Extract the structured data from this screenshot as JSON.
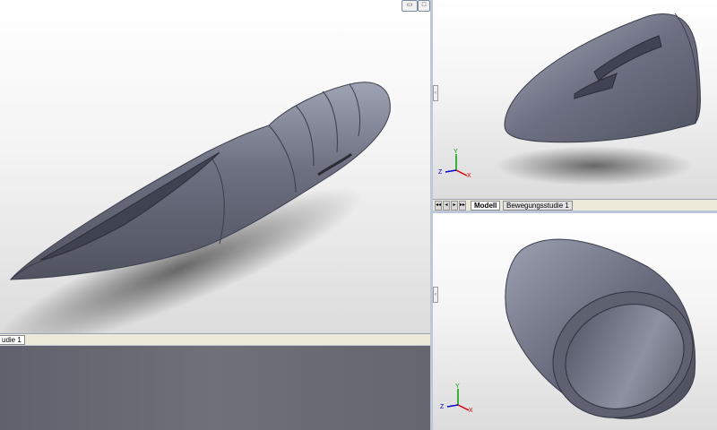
{
  "left_view": {
    "tab_label": "udie 1",
    "window_buttons": [
      "▭",
      "□"
    ]
  },
  "top_right_view": {
    "tabs": [
      {
        "label": "Modell",
        "active": true
      },
      {
        "label": "Bewegungsstudie 1",
        "active": false
      }
    ],
    "nav_buttons": [
      "◂◂",
      "◂",
      "▸",
      "▸▸"
    ],
    "triad": {
      "x": "X",
      "y": "Y",
      "z": "Z"
    }
  },
  "bottom_right_view": {
    "triad": {
      "x": "X",
      "y": "Y",
      "z": "Z"
    }
  },
  "splitter_handle": "‹",
  "colors": {
    "model": "#6a6e7e",
    "background_top": "#ffffff",
    "background_bottom": "#dcdcdc",
    "splitter": "#bcc8da",
    "triad_x": "#d40000",
    "triad_y": "#00a000",
    "triad_z": "#0000cc"
  }
}
